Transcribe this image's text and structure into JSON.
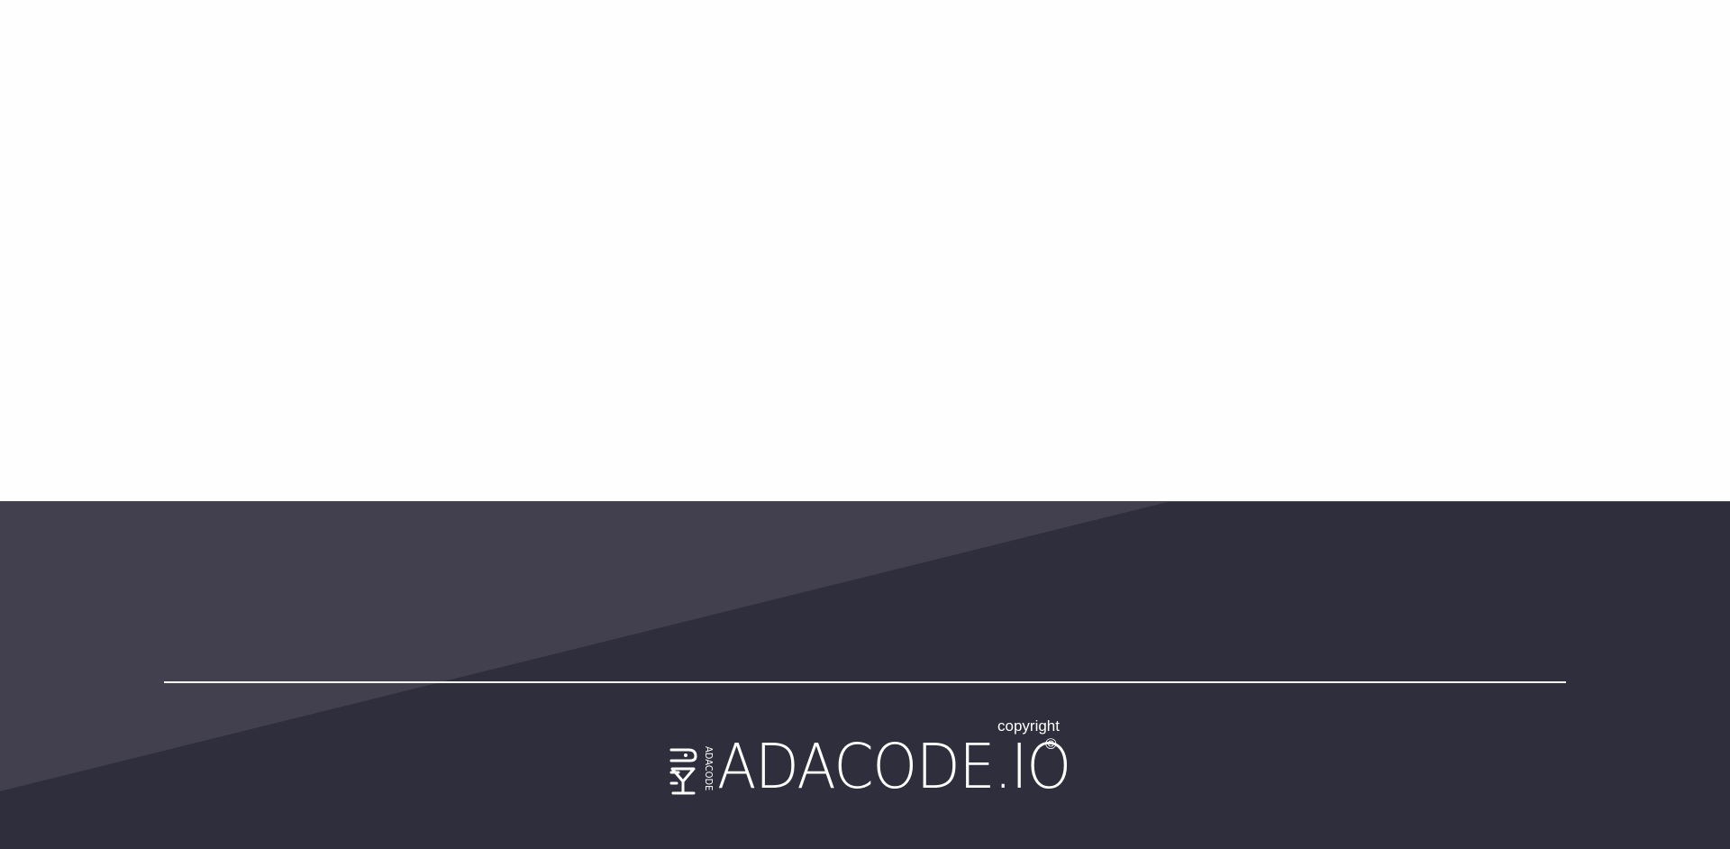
{
  "footer": {
    "brand_name": "ADACODE.IO",
    "brand_mark_text": "ADACODE",
    "copyright_label": "copyright",
    "copyright_symbol": "©",
    "logo_icon": "adacode-logo-icon"
  },
  "colors": {
    "page_background": "#fefefe",
    "footer_background": "#2f2e3c",
    "footer_diagonal": "#42404f",
    "text": "#ffffff"
  }
}
